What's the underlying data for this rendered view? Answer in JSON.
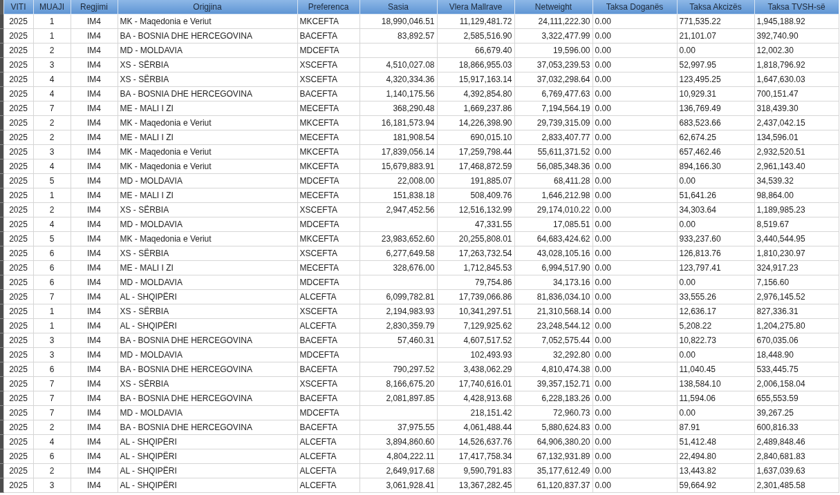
{
  "table": {
    "columns": [
      "VITI",
      "MUAJI",
      "Regjimi",
      "Origjina",
      "Preferenca",
      "Sasia",
      "Vlera Mallrave",
      "Netweight",
      "Taksa Doganës",
      "Taksa Akcizës",
      "Taksa TVSH-së"
    ],
    "rows": [
      [
        "2025",
        "1",
        "IM4",
        "MK - Maqedonia e Veriut",
        "MKCEFTA",
        "18,990,046.51",
        "11,129,481.72",
        "24,111,222.30",
        "0.00",
        "771,535.22",
        "1,945,188.92"
      ],
      [
        "2025",
        "1",
        "IM4",
        "BA - BOSNIA DHE HERCEGOVINA",
        "BACEFTA",
        "83,892.57",
        "2,585,516.90",
        "3,322,477.99",
        "0.00",
        "21,101.07",
        "392,740.90"
      ],
      [
        "2025",
        "2",
        "IM4",
        "MD - MOLDAVIA",
        "MDCEFTA",
        null,
        "66,679.40",
        "19,596.00",
        "0.00",
        "0.00",
        "12,002.30"
      ],
      [
        "2025",
        "3",
        "IM4",
        "XS - SËRBIA",
        "XSCEFTA",
        "4,510,027.08",
        "18,866,955.03",
        "37,053,239.53",
        "0.00",
        "52,997.95",
        "1,818,796.92"
      ],
      [
        "2025",
        "4",
        "IM4",
        "XS - SËRBIA",
        "XSCEFTA",
        "4,320,334.36",
        "15,917,163.14",
        "37,032,298.64",
        "0.00",
        "123,495.25",
        "1,647,630.03"
      ],
      [
        "2025",
        "4",
        "IM4",
        "BA - BOSNIA DHE HERCEGOVINA",
        "BACEFTA",
        "1,140,175.56",
        "4,392,854.80",
        "6,769,477.63",
        "0.00",
        "10,929.31",
        "700,151.47"
      ],
      [
        "2025",
        "7",
        "IM4",
        "ME - MALI I ZI",
        "MECEFTA",
        "368,290.48",
        "1,669,237.86",
        "7,194,564.19",
        "0.00",
        "136,769.49",
        "318,439.30"
      ],
      [
        "2025",
        "2",
        "IM4",
        "MK - Maqedonia e Veriut",
        "MKCEFTA",
        "16,181,573.94",
        "14,226,398.90",
        "29,739,315.09",
        "0.00",
        "683,523.66",
        "2,437,042.15"
      ],
      [
        "2025",
        "2",
        "IM4",
        "ME - MALI I ZI",
        "MECEFTA",
        "181,908.54",
        "690,015.10",
        "2,833,407.77",
        "0.00",
        "62,674.25",
        "134,596.01"
      ],
      [
        "2025",
        "3",
        "IM4",
        "MK - Maqedonia e Veriut",
        "MKCEFTA",
        "17,839,056.14",
        "17,259,798.44",
        "55,611,371.52",
        "0.00",
        "657,462.46",
        "2,932,520.51"
      ],
      [
        "2025",
        "4",
        "IM4",
        "MK - Maqedonia e Veriut",
        "MKCEFTA",
        "15,679,883.91",
        "17,468,872.59",
        "56,085,348.36",
        "0.00",
        "894,166.30",
        "2,961,143.40"
      ],
      [
        "2025",
        "5",
        "IM4",
        "MD - MOLDAVIA",
        "MDCEFTA",
        "22,008.00",
        "191,885.07",
        "68,411.28",
        "0.00",
        "0.00",
        "34,539.32"
      ],
      [
        "2025",
        "1",
        "IM4",
        "ME - MALI I ZI",
        "MECEFTA",
        "151,838.18",
        "508,409.76",
        "1,646,212.98",
        "0.00",
        "51,641.26",
        "98,864.00"
      ],
      [
        "2025",
        "2",
        "IM4",
        "XS - SËRBIA",
        "XSCEFTA",
        "2,947,452.56",
        "12,516,132.99",
        "29,174,010.22",
        "0.00",
        "34,303.64",
        "1,189,985.23"
      ],
      [
        "2025",
        "4",
        "IM4",
        "MD - MOLDAVIA",
        "MDCEFTA",
        null,
        "47,331.55",
        "17,085.51",
        "0.00",
        "0.00",
        "8,519.67"
      ],
      [
        "2025",
        "5",
        "IM4",
        "MK - Maqedonia e Veriut",
        "MKCEFTA",
        "23,983,652.60",
        "20,255,808.01",
        "64,683,424.62",
        "0.00",
        "933,237.60",
        "3,440,544.95"
      ],
      [
        "2025",
        "6",
        "IM4",
        "XS - SËRBIA",
        "XSCEFTA",
        "6,277,649.58",
        "17,263,732.54",
        "43,028,105.16",
        "0.00",
        "126,813.76",
        "1,810,230.97"
      ],
      [
        "2025",
        "6",
        "IM4",
        "ME - MALI I ZI",
        "MECEFTA",
        "328,676.00",
        "1,712,845.53",
        "6,994,517.90",
        "0.00",
        "123,797.41",
        "324,917.23"
      ],
      [
        "2025",
        "6",
        "IM4",
        "MD - MOLDAVIA",
        "MDCEFTA",
        null,
        "79,754.86",
        "34,173.16",
        "0.00",
        "0.00",
        "7,156.60"
      ],
      [
        "2025",
        "7",
        "IM4",
        "AL - SHQIPËRI",
        "ALCEFTA",
        "6,099,782.81",
        "17,739,066.86",
        "81,836,034.10",
        "0.00",
        "33,555.26",
        "2,976,145.52"
      ],
      [
        "2025",
        "1",
        "IM4",
        "XS - SËRBIA",
        "XSCEFTA",
        "2,194,983.93",
        "10,341,297.51",
        "21,310,568.14",
        "0.00",
        "12,636.17",
        "827,336.31"
      ],
      [
        "2025",
        "1",
        "IM4",
        "AL - SHQIPËRI",
        "ALCEFTA",
        "2,830,359.79",
        "7,129,925.62",
        "23,248,544.12",
        "0.00",
        "5,208.22",
        "1,204,275.80"
      ],
      [
        "2025",
        "3",
        "IM4",
        "BA - BOSNIA DHE HERCEGOVINA",
        "BACEFTA",
        "57,460.31",
        "4,607,517.52",
        "7,052,575.44",
        "0.00",
        "10,822.73",
        "670,035.06"
      ],
      [
        "2025",
        "3",
        "IM4",
        "MD - MOLDAVIA",
        "MDCEFTA",
        null,
        "102,493.93",
        "32,292.80",
        "0.00",
        "0.00",
        "18,448.90"
      ],
      [
        "2025",
        "6",
        "IM4",
        "BA - BOSNIA DHE HERCEGOVINA",
        "BACEFTA",
        "790,297.52",
        "3,438,062.29",
        "4,810,474.38",
        "0.00",
        "11,040.45",
        "533,445.75"
      ],
      [
        "2025",
        "7",
        "IM4",
        "XS - SËRBIA",
        "XSCEFTA",
        "8,166,675.20",
        "17,740,616.01",
        "39,357,152.71",
        "0.00",
        "138,584.10",
        "2,006,158.04"
      ],
      [
        "2025",
        "7",
        "IM4",
        "BA - BOSNIA DHE HERCEGOVINA",
        "BACEFTA",
        "2,081,897.85",
        "4,428,913.68",
        "6,228,183.26",
        "0.00",
        "11,594.06",
        "655,553.59"
      ],
      [
        "2025",
        "7",
        "IM4",
        "MD - MOLDAVIA",
        "MDCEFTA",
        null,
        "218,151.42",
        "72,960.73",
        "0.00",
        "0.00",
        "39,267.25"
      ],
      [
        "2025",
        "2",
        "IM4",
        "BA - BOSNIA DHE HERCEGOVINA",
        "BACEFTA",
        "37,975.55",
        "4,061,488.44",
        "5,880,624.83",
        "0.00",
        "87.91",
        "600,816.33"
      ],
      [
        "2025",
        "4",
        "IM4",
        "AL - SHQIPËRI",
        "ALCEFTA",
        "3,894,860.60",
        "14,526,637.76",
        "64,906,380.20",
        "0.00",
        "51,412.48",
        "2,489,848.46"
      ],
      [
        "2025",
        "6",
        "IM4",
        "AL - SHQIPËRI",
        "ALCEFTA",
        "4,804,222.11",
        "17,417,758.34",
        "67,132,931.89",
        "0.00",
        "22,494.80",
        "2,840,681.83"
      ],
      [
        "2025",
        "2",
        "IM4",
        "AL - SHQIPËRI",
        "ALCEFTA",
        "2,649,917.68",
        "9,590,791.83",
        "35,177,612.49",
        "0.00",
        "13,443.82",
        "1,637,039.63"
      ],
      [
        "2025",
        "3",
        "IM4",
        "AL - SHQIPËRI",
        "ALCEFTA",
        "3,061,928.41",
        "13,367,282.45",
        "61,120,837.37",
        "0.00",
        "59,664.92",
        "2,301,485.58"
      ]
    ]
  }
}
